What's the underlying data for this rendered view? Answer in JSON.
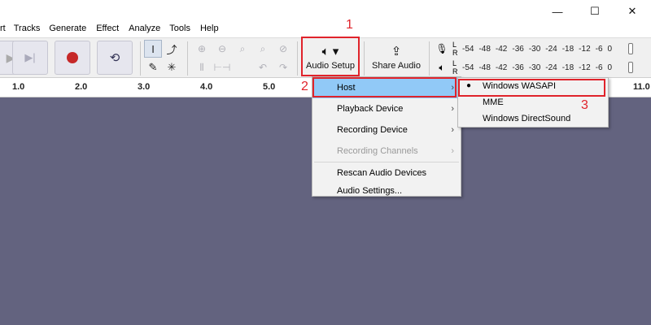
{
  "menubar": {
    "items": [
      "rt",
      "Tracks",
      "Generate",
      "Effect",
      "Analyze",
      "Tools",
      "Help"
    ],
    "controls": {
      "minimize": "—",
      "maximize": "☐",
      "close": "✕"
    }
  },
  "toolbar": {
    "audio_setup_label": "Audio Setup",
    "share_audio_label": "Share Audio"
  },
  "meters": {
    "record": {
      "l": "L",
      "r": "R",
      "scale": [
        "-54",
        "-48",
        "-42",
        "-36",
        "-30",
        "-24",
        "-18",
        "-12",
        "-6",
        "0"
      ]
    },
    "play": {
      "l": "L",
      "r": "R",
      "scale": [
        "-54",
        "-48",
        "-42",
        "-36",
        "-30",
        "-24",
        "-18",
        "-12",
        "-6",
        "0"
      ]
    }
  },
  "ruler": {
    "ticks": [
      "1.0",
      "2.0",
      "3.0",
      "4.0",
      "5.0",
      "11.0"
    ]
  },
  "annotations": {
    "step1": "1",
    "step2": "2",
    "step3": "3"
  },
  "audio_menu": {
    "items": [
      {
        "label": "Host",
        "submenu": true
      },
      {
        "label": "Playback Device",
        "submenu": true
      },
      {
        "label": "Recording Device",
        "submenu": true
      },
      {
        "label": "Recording Channels",
        "submenu": true,
        "disabled": true
      },
      {
        "label": "Rescan Audio Devices"
      },
      {
        "label": "Audio Settings..."
      }
    ]
  },
  "host_menu": {
    "items": [
      "Windows WASAPI",
      "MME",
      "Windows DirectSound"
    ],
    "selected": "Windows WASAPI"
  },
  "colors": {
    "track_bg": "#63637f",
    "highlight": "#e0232b",
    "menu_active": "#91c9f7",
    "record": "#c62828"
  }
}
